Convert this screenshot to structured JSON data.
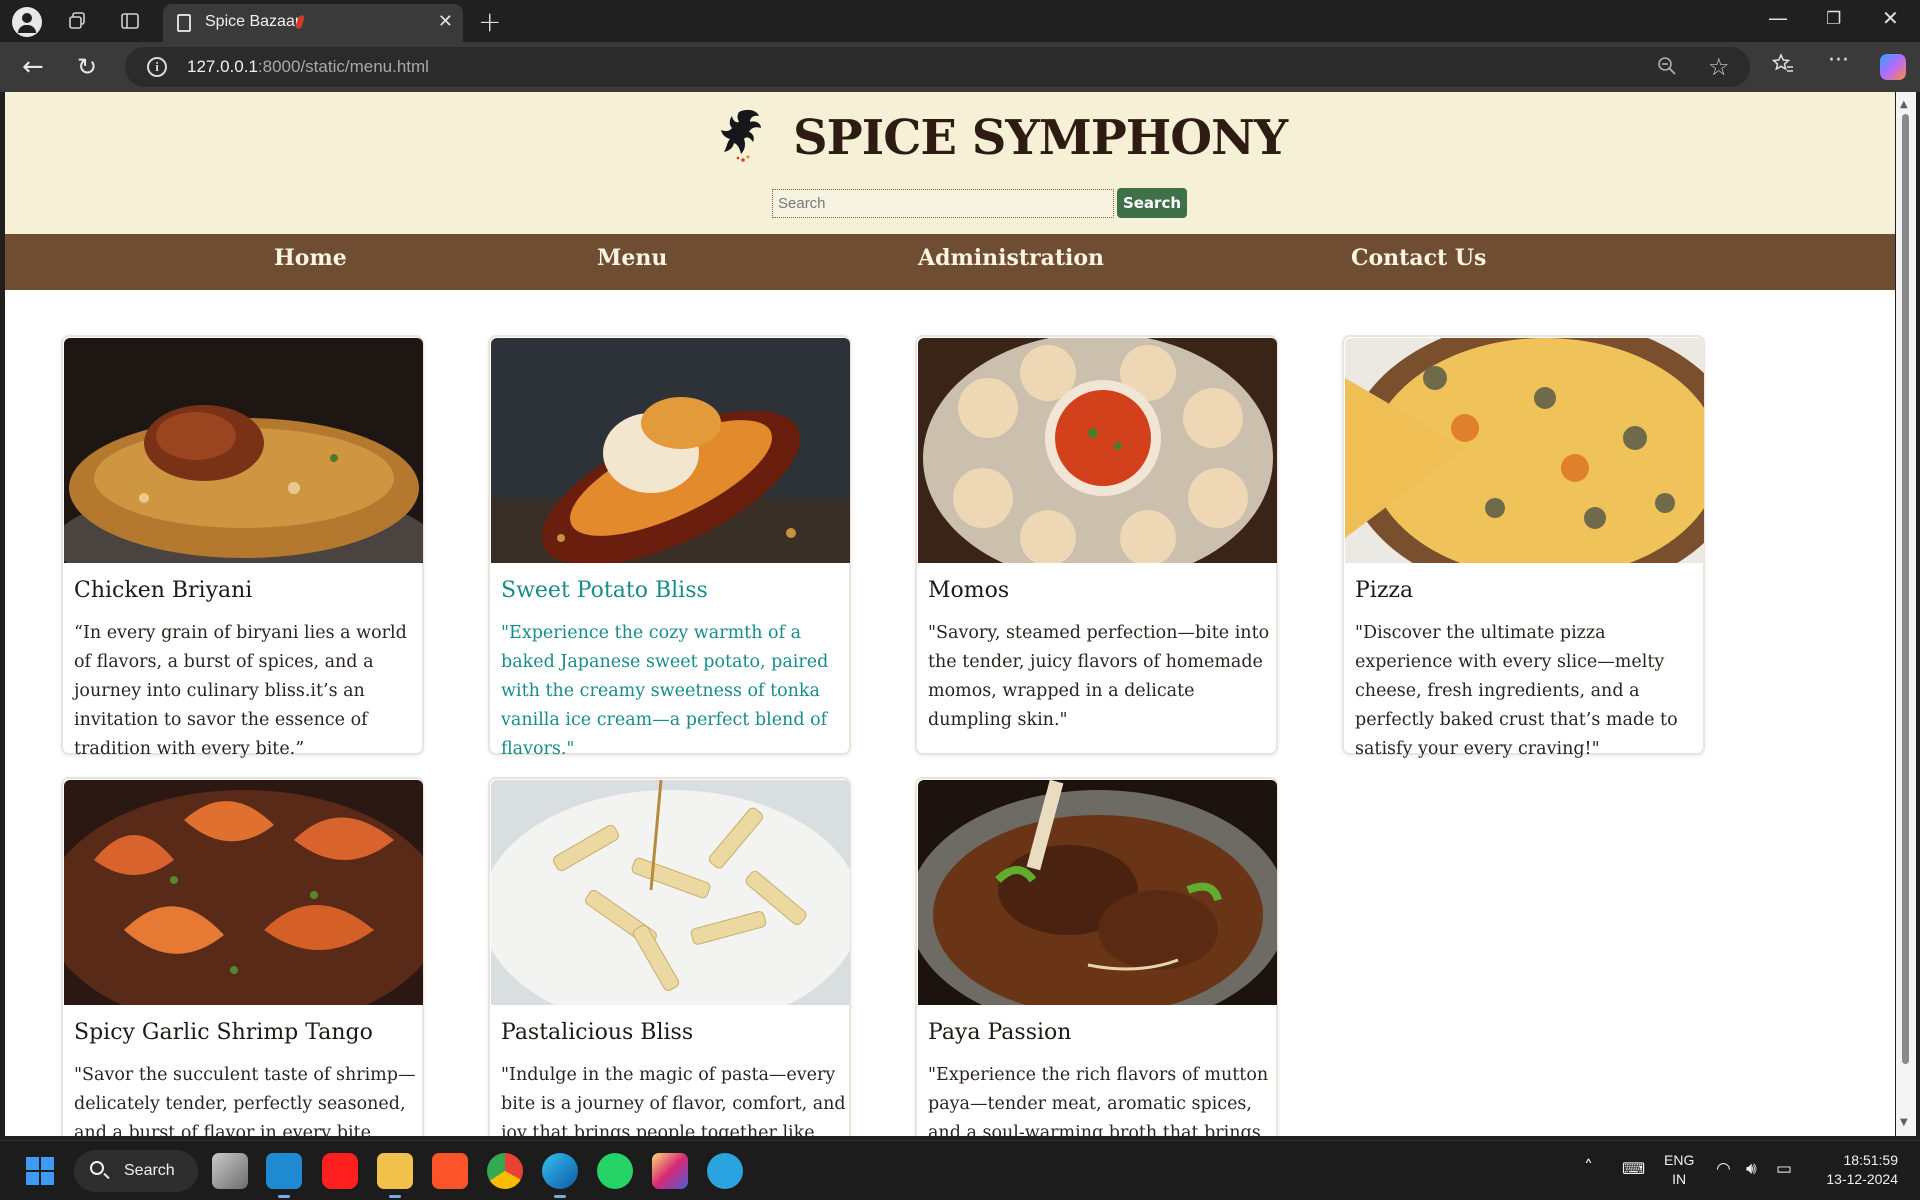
{
  "browser": {
    "tab_title": "Spice Bazaar",
    "url_host": "127.0.0.1",
    "url_rest": ":8000/static/menu.html"
  },
  "site": {
    "brand": "SPICE SYMPHONY",
    "search_placeholder": "Search",
    "search_button": "Search",
    "nav": [
      "Home",
      "Menu",
      "Administration",
      "Contact Us"
    ],
    "colors": {
      "header_bg": "#f6f1d6",
      "nav_bg": "#6f4d33",
      "button_bg": "#3f7149",
      "hover_text": "#178c8a"
    }
  },
  "menu": {
    "items": [
      {
        "name": "Chicken Briyani",
        "description": "“In every grain of biryani lies a world of flavors, a burst of spices, and a journey into culinary bliss.it’s an invitation to savor the essence of tradition with every bite.”"
      },
      {
        "name": "Sweet Potato Bliss",
        "description": "\"Experience the cozy warmth of a baked Japanese sweet potato, paired with the creamy sweetness of tonka vanilla ice cream—a perfect blend of flavors.\""
      },
      {
        "name": "Momos",
        "description": "\"Savory, steamed perfection—bite into the tender, juicy flavors of homemade momos, wrapped in a delicate dumpling skin.\""
      },
      {
        "name": "Pizza",
        "description": "\"Discover the ultimate pizza experience with every slice—melty cheese, fresh ingredients, and a perfectly baked crust that’s made to satisfy your every craving!\""
      },
      {
        "name": "Spicy Garlic Shrimp Tango",
        "description": "\"Savor the succulent taste of shrimp—delicately tender, perfectly seasoned, and a burst of flavor in every bite, leaving you craving more.\""
      },
      {
        "name": "Pastalicious Bliss",
        "description": "\"Indulge in the magic of pasta—every bite is a journey of flavor, comfort, and joy that brings people together like nothing else.\""
      },
      {
        "name": "Paya Passion",
        "description": "\"Experience the rich flavors of mutton paya—tender meat, aromatic spices, and a soul-warming broth that brings comfort with every spoonful.\""
      }
    ]
  },
  "taskbar": {
    "search_label": "Search",
    "lang_top": "ENG",
    "lang_bottom": "IN",
    "time": "18:51:59",
    "date": "13-12-2024"
  }
}
